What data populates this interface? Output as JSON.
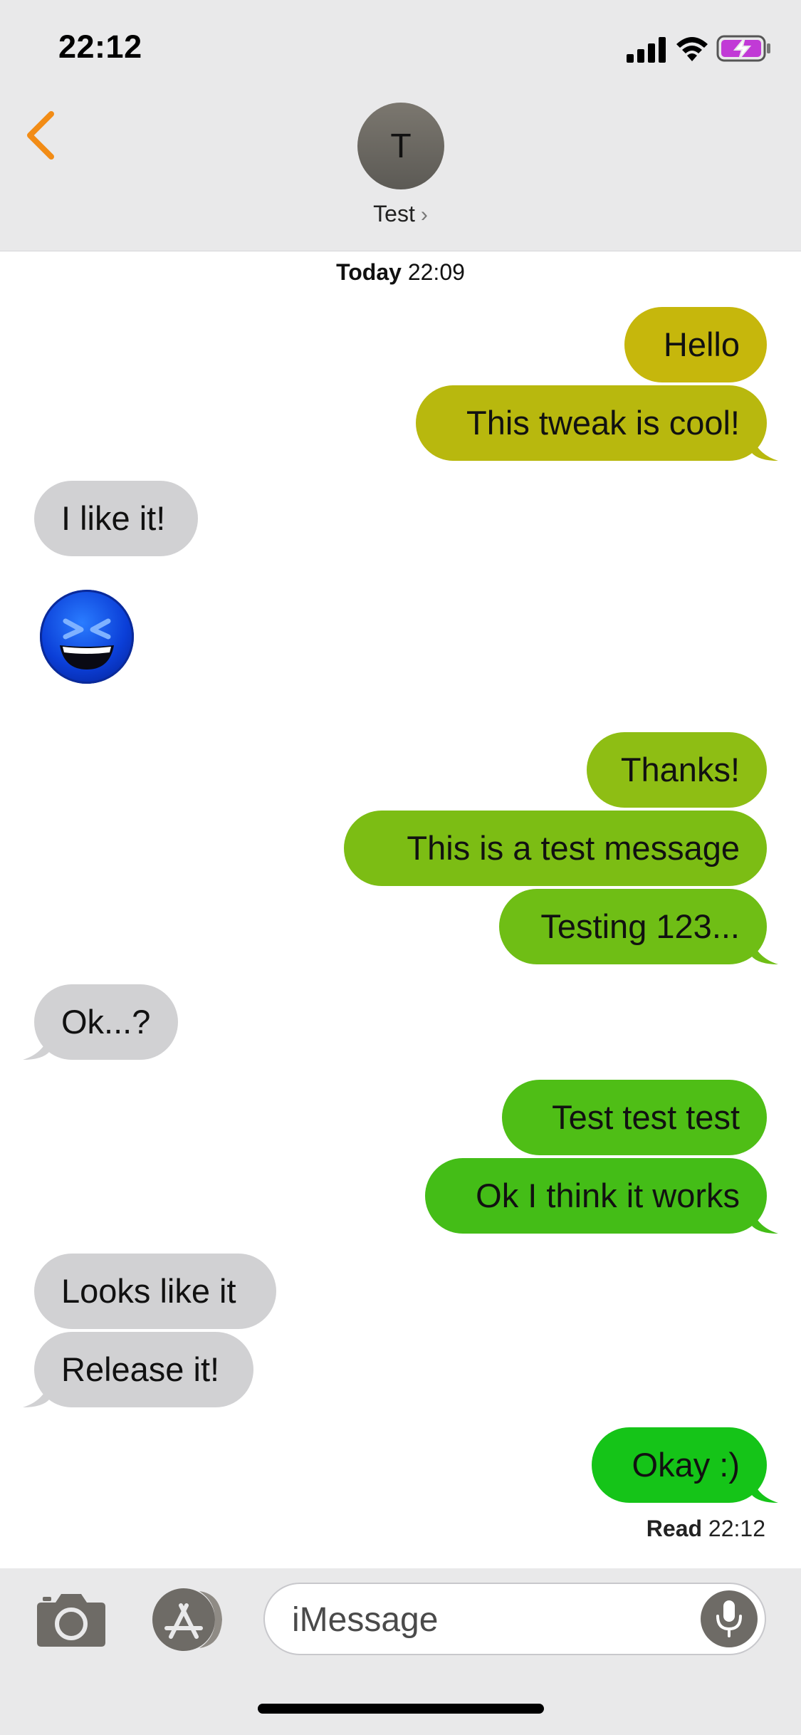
{
  "status_bar": {
    "time": "22:12"
  },
  "header": {
    "avatar_initial": "T",
    "contact_name": "Test",
    "chevron": "›"
  },
  "conversation": {
    "timestamp_day": "Today",
    "timestamp_time": "22:09",
    "messages": [
      {
        "text": "Hello",
        "direction": "outgoing",
        "color": "#c6b70c"
      },
      {
        "text": "This tweak is cool!",
        "direction": "outgoing",
        "color": "#b8b80e"
      },
      {
        "text": "I like it!",
        "direction": "incoming",
        "color": "#d1d1d3"
      },
      {
        "text": "",
        "direction": "incoming",
        "emoji": "laughing-face-icon"
      },
      {
        "text": "Thanks!",
        "direction": "outgoing",
        "color": "#8ebe14"
      },
      {
        "text": "This is a test message",
        "direction": "outgoing",
        "color": "#7cbd14"
      },
      {
        "text": "Testing 123...",
        "direction": "outgoing",
        "color": "#6fbe15"
      },
      {
        "text": "Ok...?",
        "direction": "incoming",
        "color": "#d1d1d3"
      },
      {
        "text": "Test test test",
        "direction": "outgoing",
        "color": "#4fbe16"
      },
      {
        "text": "Ok I think it works",
        "direction": "outgoing",
        "color": "#44bd17"
      },
      {
        "text": "Looks like it",
        "direction": "incoming",
        "color": "#d1d1d3"
      },
      {
        "text": "Release it!",
        "direction": "incoming",
        "color": "#d1d1d3"
      },
      {
        "text": "Okay :)",
        "direction": "outgoing",
        "color": "#15c418"
      }
    ],
    "read_label": "Read",
    "read_time": "22:12"
  },
  "input_bar": {
    "placeholder": "iMessage"
  },
  "colors": {
    "accent": "#f28c16",
    "incoming_bubble": "#d1d1d3",
    "header_bg": "#e9e9ea"
  }
}
